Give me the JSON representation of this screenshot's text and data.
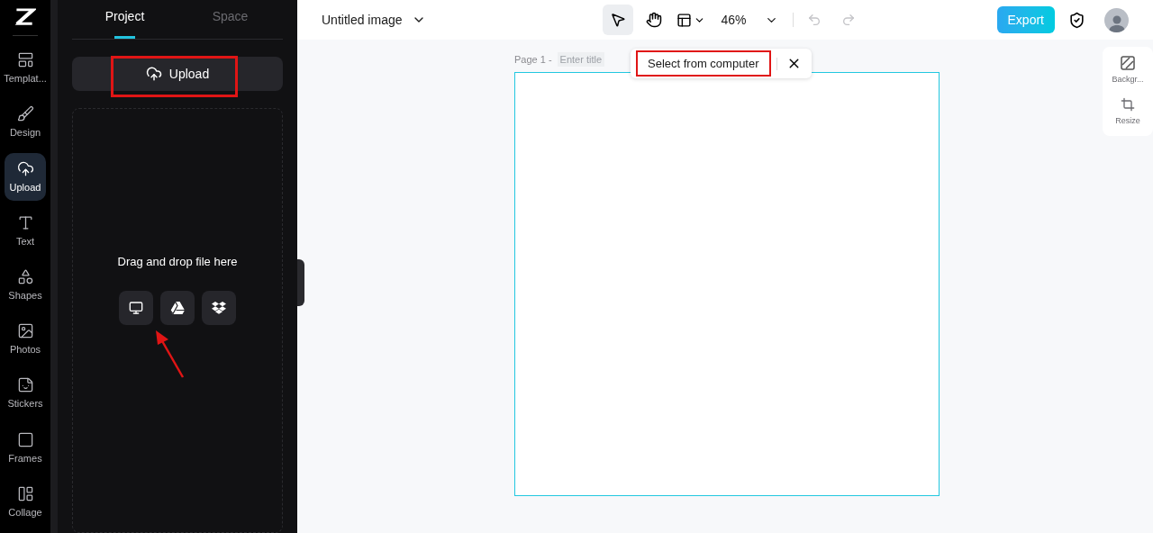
{
  "rail": [
    {
      "label": "Templat...",
      "kind": "template",
      "selected": false
    },
    {
      "label": "Design",
      "kind": "design",
      "selected": false
    },
    {
      "label": "Upload",
      "kind": "upload",
      "selected": true
    },
    {
      "label": "Text",
      "kind": "text",
      "selected": false
    },
    {
      "label": "Shapes",
      "kind": "shapes",
      "selected": false
    },
    {
      "label": "Photos",
      "kind": "photos",
      "selected": false
    },
    {
      "label": "Stickers",
      "kind": "stickers",
      "selected": false
    },
    {
      "label": "Frames",
      "kind": "frames",
      "selected": false
    },
    {
      "label": "Collage",
      "kind": "collage",
      "selected": false
    }
  ],
  "panel": {
    "tabs": [
      {
        "label": "Project",
        "selected": true
      },
      {
        "label": "Space",
        "selected": false
      }
    ],
    "upload_button": "Upload",
    "drop_text": "Drag and drop file here",
    "sources": [
      {
        "kind": "computer"
      },
      {
        "kind": "drive"
      },
      {
        "kind": "dropbox"
      }
    ]
  },
  "topbar": {
    "title": "Untitled image",
    "zoom": "46%",
    "export": "Export"
  },
  "canvas": {
    "page_label": "Page 1 -",
    "title_placeholder": "Enter title",
    "popup": "Select from computer"
  },
  "side_tools": [
    {
      "label": "Backgr...",
      "kind": "background"
    },
    {
      "label": "Resize",
      "kind": "resize"
    }
  ]
}
